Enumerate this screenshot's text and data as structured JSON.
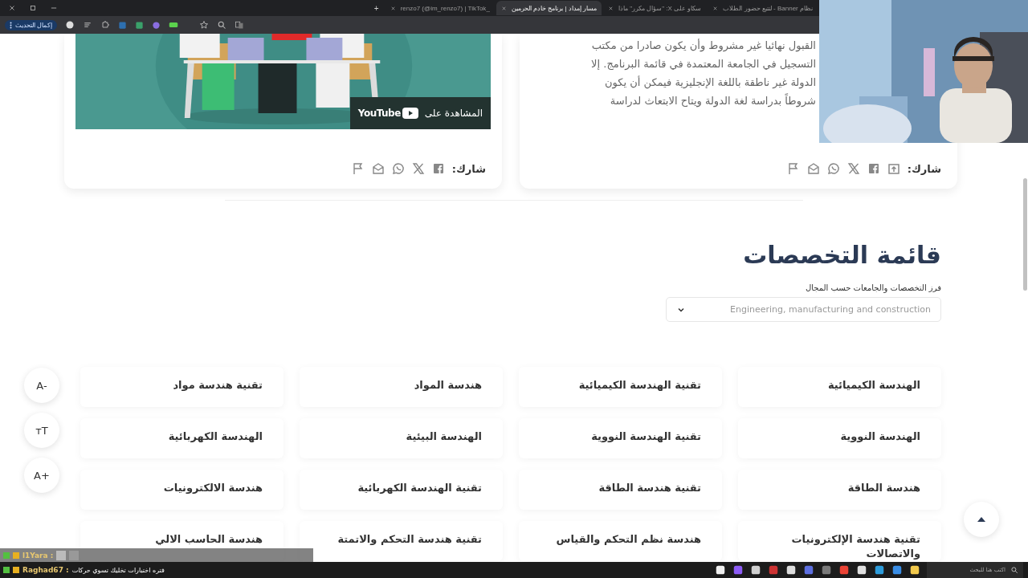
{
  "browser": {
    "tabs": [
      {
        "title": "نظام Banner - لتتبع حضور الطلاب",
        "selected": false
      },
      {
        "title": "سكاو على X: \"سؤال مكرر\" ماذا",
        "selected": false
      },
      {
        "title": "مسار إمداد | برنامج خادم الحرمين",
        "selected": true
      },
      {
        "title": "_renzo7 (@im_renzo7) | TikTok",
        "selected": false
      }
    ],
    "new_tab": "+",
    "update_button": "إكمال التحديث"
  },
  "video_card": {
    "watch_on": "المشاهدة على",
    "brand": "YouTube",
    "share_label": "شارك:"
  },
  "text_card": {
    "lines": [
      "القبول نهائيا غير مشروط وأن يكون صادرا من مكتب",
      "التسجيل في الجامعة المعتمدة في قائمة البرنامج. إلا",
      "الدولة غير ناطقة باللغة الإنجليزية فيمكن أن يكون",
      "شروطاً بدراسة لغة الدولة ويتاح الابتعاث لدراسة"
    ],
    "share_label": "شارك:"
  },
  "specialties": {
    "title": "قائمة التخصصات",
    "filter_label": "فرز التخصصات والجامعات حسب المجال",
    "filter": {
      "value": "Engineering, manufacturing and construction"
    },
    "items": [
      "الهندسة الكيميائية",
      "تقنية الهندسة الكيميائية",
      "هندسة المواد",
      "تقنية هندسة مواد",
      "الهندسة النووية",
      "تقنية الهندسة النووية",
      "الهندسة البيئية",
      "الهندسة الكهربائية",
      "هندسة الطاقة",
      "تقنية هندسة الطاقة",
      "تقنية الهندسة الكهربائية",
      "هندسة الالكترونيات",
      "تقنية هندسة الإلكترونيات والاتصالات",
      "هندسة نظم التحكم والقياس",
      "تقنية هندسة التحكم والاتمتة",
      "هندسة الحاسب الالي"
    ]
  },
  "font_controls": [
    "A-",
    "ᴛT",
    "A+"
  ],
  "chat": [
    {
      "user": "l1Yara :",
      "kind": "emotes"
    },
    {
      "user": "Raghad67 :",
      "kind": "text",
      "message": "فتره اختبارات تخليك تسوي حركات"
    }
  ],
  "taskbar": {
    "search_placeholder": "اكتب هنا للبحث"
  }
}
